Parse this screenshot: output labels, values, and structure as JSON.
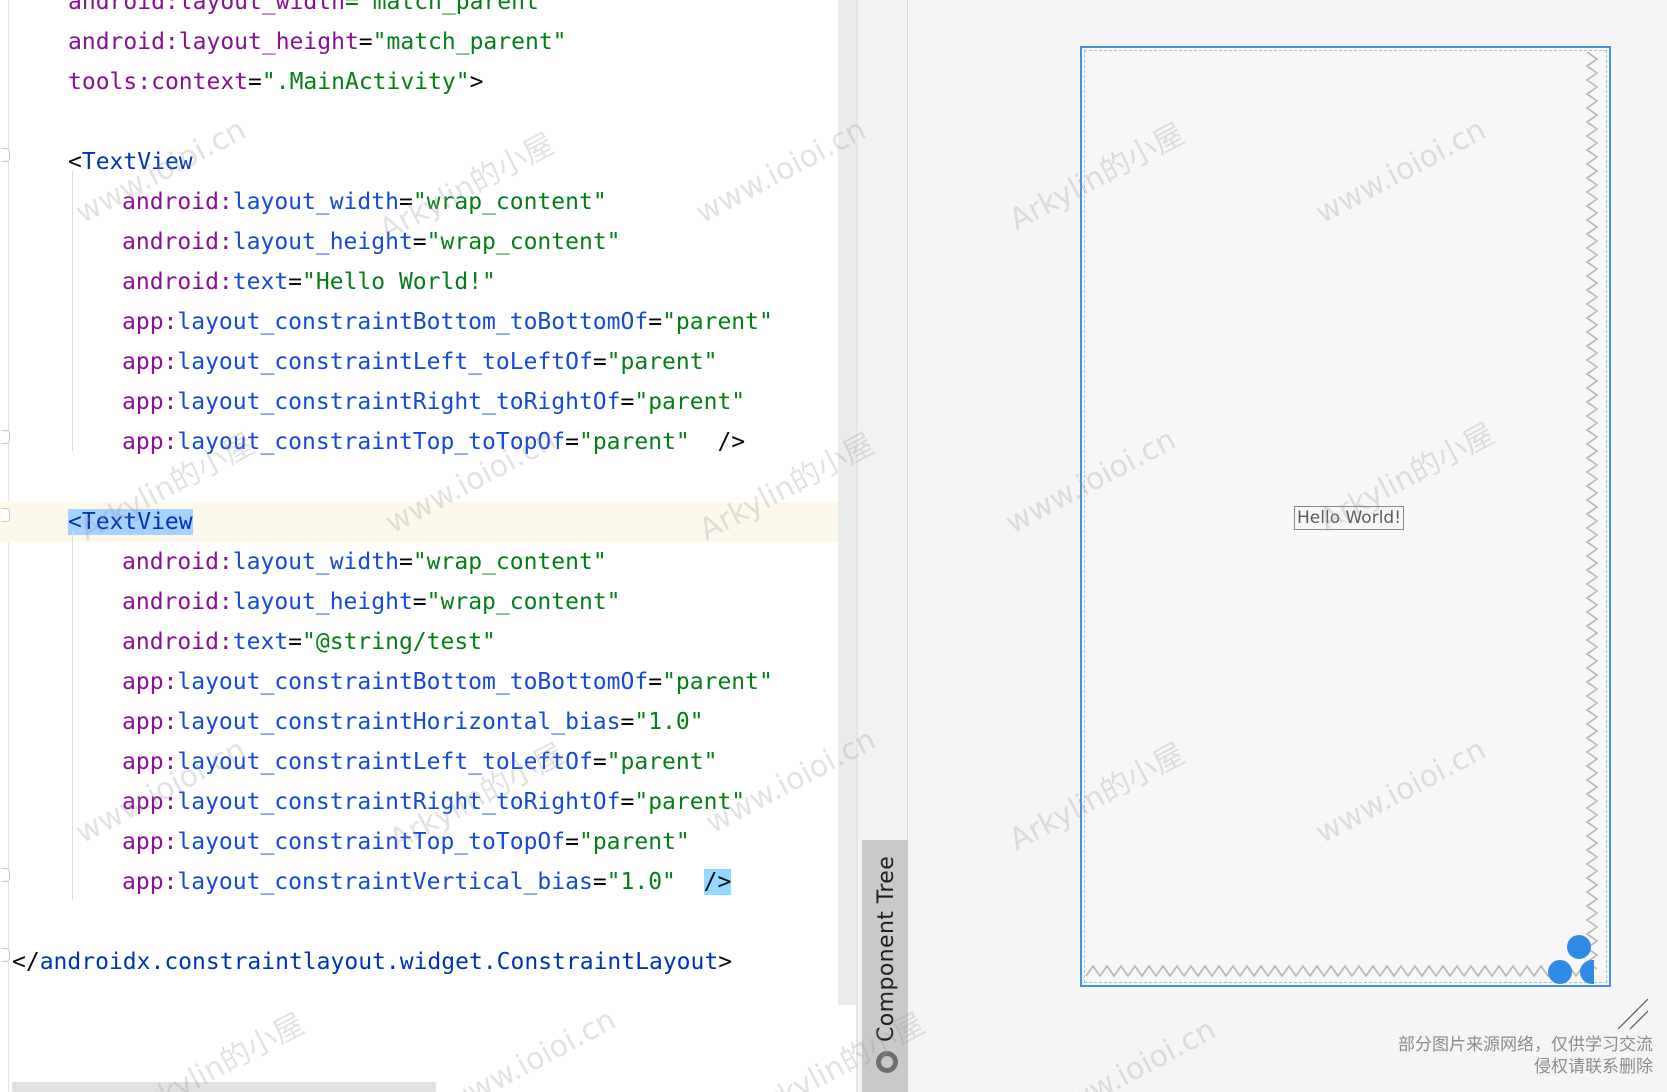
{
  "editor": {
    "lines": [
      [
        [
          "android:",
          "t-ns"
        ],
        [
          "layout_width",
          "t-ns"
        ],
        [
          "=\"match_parent\"",
          "t-val"
        ]
      ],
      [
        [
          "android:",
          "t-ns"
        ],
        [
          "layout_height",
          "t-ns"
        ],
        [
          "=",
          "t-punc"
        ],
        [
          "\"match_parent\"",
          "t-val"
        ]
      ],
      [
        [
          "tools:",
          "t-ns"
        ],
        [
          "context",
          "t-ns"
        ],
        [
          "=",
          "t-punc"
        ],
        [
          "\".MainActivity\"",
          "t-val"
        ],
        [
          ">",
          "t-punc"
        ]
      ],
      [],
      [
        [
          "<",
          "t-punc"
        ],
        [
          "TextView",
          "t-tagname"
        ]
      ],
      [
        [
          "android:",
          "t-ns"
        ],
        [
          "layout_width",
          "t-attr"
        ],
        [
          "=",
          "t-punc"
        ],
        [
          "\"wrap_content\"",
          "t-val"
        ]
      ],
      [
        [
          "android:",
          "t-ns"
        ],
        [
          "layout_height",
          "t-attr"
        ],
        [
          "=",
          "t-punc"
        ],
        [
          "\"wrap_content\"",
          "t-val"
        ]
      ],
      [
        [
          "android:",
          "t-ns"
        ],
        [
          "text",
          "t-attr"
        ],
        [
          "=",
          "t-punc"
        ],
        [
          "\"Hello World!\"",
          "t-val"
        ]
      ],
      [
        [
          "app:",
          "t-ns"
        ],
        [
          "layout_constraintBottom_toBottomOf",
          "t-attr"
        ],
        [
          "=",
          "t-punc"
        ],
        [
          "\"parent\"",
          "t-val"
        ]
      ],
      [
        [
          "app:",
          "t-ns"
        ],
        [
          "layout_constraintLeft_toLeftOf",
          "t-attr"
        ],
        [
          "=",
          "t-punc"
        ],
        [
          "\"parent\"",
          "t-val"
        ]
      ],
      [
        [
          "app:",
          "t-ns"
        ],
        [
          "layout_constraintRight_toRightOf",
          "t-attr"
        ],
        [
          "=",
          "t-punc"
        ],
        [
          "\"parent\"",
          "t-val"
        ]
      ],
      [
        [
          "app:",
          "t-ns"
        ],
        [
          "layout_constraintTop_toTopOf",
          "t-attr"
        ],
        [
          "=",
          "t-punc"
        ],
        [
          "\"parent\"",
          "t-val"
        ],
        [
          "  />",
          "t-punc"
        ]
      ],
      [],
      [
        [
          "<TextView",
          "t-tagname hl-sel"
        ]
      ],
      [
        [
          "android:",
          "t-ns"
        ],
        [
          "layout_width",
          "t-attr"
        ],
        [
          "=",
          "t-punc"
        ],
        [
          "\"wrap_content\"",
          "t-val"
        ]
      ],
      [
        [
          "android:",
          "t-ns"
        ],
        [
          "layout_height",
          "t-attr"
        ],
        [
          "=",
          "t-punc"
        ],
        [
          "\"wrap_content\"",
          "t-val"
        ]
      ],
      [
        [
          "android:",
          "t-ns"
        ],
        [
          "text",
          "t-attr"
        ],
        [
          "=",
          "t-punc"
        ],
        [
          "\"@string/test\"",
          "t-val"
        ]
      ],
      [
        [
          "app:",
          "t-ns"
        ],
        [
          "layout_constraintBottom_toBottomOf",
          "t-attr"
        ],
        [
          "=",
          "t-punc"
        ],
        [
          "\"parent\"",
          "t-val"
        ]
      ],
      [
        [
          "app:",
          "t-ns"
        ],
        [
          "layout_constraintHorizontal_bias",
          "t-attr"
        ],
        [
          "=",
          "t-punc"
        ],
        [
          "\"1.0\"",
          "t-val"
        ]
      ],
      [
        [
          "app:",
          "t-ns"
        ],
        [
          "layout_constraintLeft_toLeftOf",
          "t-attr"
        ],
        [
          "=",
          "t-punc"
        ],
        [
          "\"parent\"",
          "t-val"
        ]
      ],
      [
        [
          "app:",
          "t-ns"
        ],
        [
          "layout_constraintRight_toRightOf",
          "t-attr"
        ],
        [
          "=",
          "t-punc"
        ],
        [
          "\"parent\"",
          "t-val"
        ]
      ],
      [
        [
          "app:",
          "t-ns"
        ],
        [
          "layout_constraintTop_toTopOf",
          "t-attr"
        ],
        [
          "=",
          "t-punc"
        ],
        [
          "\"parent\"",
          "t-val"
        ]
      ],
      [
        [
          "app:",
          "t-ns"
        ],
        [
          "layout_constraintVertical_bias",
          "t-attr"
        ],
        [
          "=",
          "t-punc"
        ],
        [
          "\"1.0\"",
          "t-val"
        ],
        [
          "  ",
          "t-punc"
        ],
        [
          "/>",
          "t-punc hl-match"
        ]
      ],
      [],
      [
        [
          "</",
          "t-punc"
        ],
        [
          "androidx.constraintlayout.widget.ConstraintLayout",
          "t-tagname"
        ],
        [
          ">",
          "t-punc"
        ]
      ]
    ]
  },
  "component_tree": {
    "label": "Component Tree",
    "icon": "globe-icon"
  },
  "preview": {
    "hello_text": "Hello World!",
    "accent_color": "#2f8be6",
    "device_border_color": "#4a90d9"
  },
  "footer_note": {
    "line1": "部分图片来源网络，仅供学习交流",
    "line2": "侵权请联系删除"
  },
  "watermarks": {
    "site": "www.ioioi.cn",
    "brand": "Arkylin的小屋"
  }
}
